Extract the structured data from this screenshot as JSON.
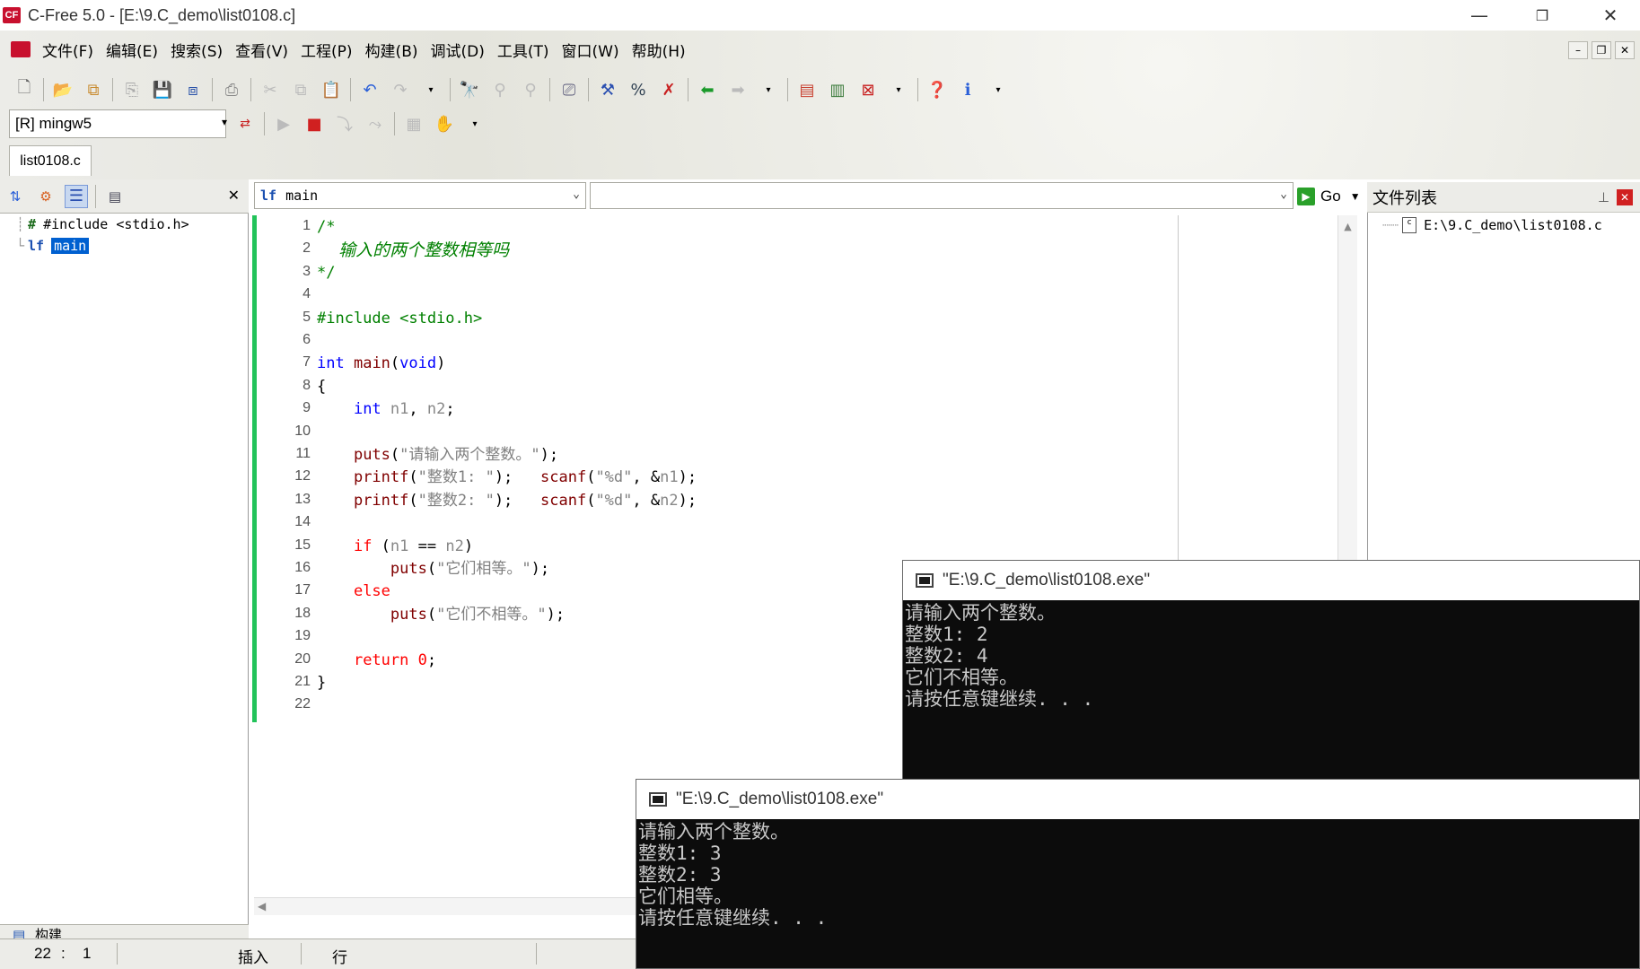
{
  "window": {
    "title": "C-Free 5.0 - [E:\\9.C_demo\\list0108.c]",
    "app_icon": "CF"
  },
  "menu": [
    "文件(F)",
    "编辑(E)",
    "搜索(S)",
    "查看(V)",
    "工程(P)",
    "构建(B)",
    "调试(D)",
    "工具(T)",
    "窗口(W)",
    "帮助(H)"
  ],
  "toolbar": {
    "compiler": "[R] mingw5"
  },
  "tab": {
    "label": "list0108.c"
  },
  "symbol_tree": [
    {
      "icon": "#",
      "label": "#include <stdio.h>"
    },
    {
      "icon": "lf",
      "label": "main"
    }
  ],
  "editor": {
    "function_combo": "main",
    "go_label": "Go",
    "lines": [
      {
        "n": "1",
        "html": "<span class='cm'>/*</span>"
      },
      {
        "n": "2",
        "html": "<span class='cm' style='font-style:italic;font-family:\"DejaVu Sans\",sans-serif;font-size:19px'>    输入的两个整数相等吗</span>"
      },
      {
        "n": "3",
        "html": "<span class='cm'>*/</span>"
      },
      {
        "n": "4",
        "html": ""
      },
      {
        "n": "5",
        "html": "<span class='pp'>#include &lt;stdio.h&gt;</span>"
      },
      {
        "n": "6",
        "html": ""
      },
      {
        "n": "7",
        "html": "<span class='kw'>int</span> <span class='fn'>main</span>(<span class='kw'>void</span>)"
      },
      {
        "n": "8",
        "html": "{"
      },
      {
        "n": "9",
        "html": "    <span class='kw'>int</span> <span class='id'>n1</span>, <span class='id'>n2</span>;"
      },
      {
        "n": "10",
        "html": ""
      },
      {
        "n": "11",
        "html": "    <span class='fn'>puts</span>(<span class='str'>\"请输入两个整数。\"</span>);"
      },
      {
        "n": "12",
        "html": "    <span class='fn'>printf</span>(<span class='str'>\"整数1: \"</span>);   <span class='fn'>scanf</span>(<span class='str'>\"%d\"</span>, &amp;<span class='id'>n1</span>);"
      },
      {
        "n": "13",
        "html": "    <span class='fn'>printf</span>(<span class='str'>\"整数2: \"</span>);   <span class='fn'>scanf</span>(<span class='str'>\"%d\"</span>, &amp;<span class='id'>n2</span>);"
      },
      {
        "n": "14",
        "html": ""
      },
      {
        "n": "15",
        "html": "    <span class='kw' style='color:#ff0000'>if</span> (<span class='id'>n1</span> == <span class='id'>n2</span>)"
      },
      {
        "n": "16",
        "html": "        <span class='fn'>puts</span>(<span class='str'>\"它们相等。\"</span>);"
      },
      {
        "n": "17",
        "html": "    <span class='kw' style='color:#ff0000'>else</span>"
      },
      {
        "n": "18",
        "html": "        <span class='fn'>puts</span>(<span class='str'>\"它们不相等。\"</span>);"
      },
      {
        "n": "19",
        "html": ""
      },
      {
        "n": "20",
        "html": "    <span class='kw' style='color:#ff0000'>return</span> <span class='num'>0</span>;"
      },
      {
        "n": "21",
        "html": "}"
      },
      {
        "n": "22",
        "html": ""
      }
    ]
  },
  "file_list": {
    "title": "文件列表",
    "files": [
      "E:\\9.C_demo\\list0108.c"
    ]
  },
  "console1": {
    "title": "\"E:\\9.C_demo\\list0108.exe\"",
    "text": "请输入两个整数。\n整数1: 2\n整数2: 4\n它们不相等。\n请按任意键继续. . ."
  },
  "console2": {
    "title": "\"E:\\9.C_demo\\list0108.exe\"",
    "text": "请输入两个整数。\n整数1: 3\n整数2: 3\n它们相等。\n请按任意键继续. . ."
  },
  "build_tab": "构建",
  "status": {
    "line": "22",
    "sep": ":",
    "col": "1",
    "mode": "插入",
    "row_label": "行"
  },
  "colors": {
    "accent_green": "#22c35a",
    "keyword": "#0000ff",
    "comment": "#008000"
  }
}
